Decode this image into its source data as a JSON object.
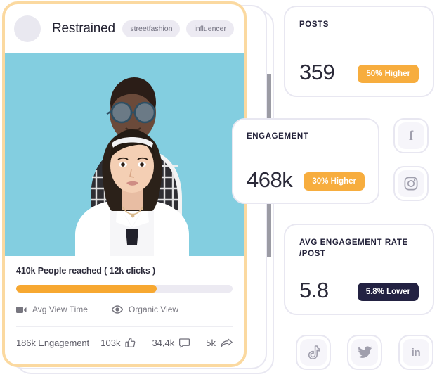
{
  "post_card": {
    "author": "Restrained",
    "avatar_icon": "avatar-placeholder-icon",
    "tags": [
      "streetfashion",
      "influencer"
    ],
    "photo_alt": "two-people-portrait-photo",
    "reach_text": "410k People reached ( 12k clicks )",
    "progress_percent": 65,
    "legend": [
      {
        "label": "Avg View Time",
        "icon": "video-camera-icon"
      },
      {
        "label": "Organic View",
        "icon": "eye-icon"
      }
    ],
    "engagement_label": "186k Engagement",
    "metrics": [
      {
        "value": "103k",
        "icon": "thumbs-up-icon"
      },
      {
        "value": "34,4k",
        "icon": "comment-icon"
      },
      {
        "value": "5k",
        "icon": "share-icon"
      }
    ]
  },
  "kpis": {
    "posts": {
      "title": "POSTS",
      "value": "359",
      "badge": "50% Higher",
      "badge_type": "up"
    },
    "engagement": {
      "title": "ENGAGEMENT",
      "value": "468k",
      "badge": "30% Higher",
      "badge_type": "up"
    },
    "rate": {
      "title": "AVG ENGAGEMENT RATE /POST",
      "value": "5.8",
      "badge": "5.8% Lower",
      "badge_type": "down"
    }
  },
  "social_buttons": [
    {
      "name": "facebook",
      "icon": "facebook-icon",
      "glyph": "f"
    },
    {
      "name": "instagram",
      "icon": "instagram-icon"
    },
    {
      "name": "tiktok",
      "icon": "tiktok-icon"
    },
    {
      "name": "twitter",
      "icon": "twitter-icon"
    },
    {
      "name": "linkedin",
      "icon": "linkedin-icon",
      "glyph": "in"
    }
  ],
  "colors": {
    "accent_orange": "#f7a831",
    "badge_dark": "#232242",
    "card_border": "#e8e7f1",
    "post_border": "#fbd9a0",
    "photo_bg": "#83cee0",
    "tag_bg": "#eceaf2",
    "track_bg": "#eceaf2"
  }
}
